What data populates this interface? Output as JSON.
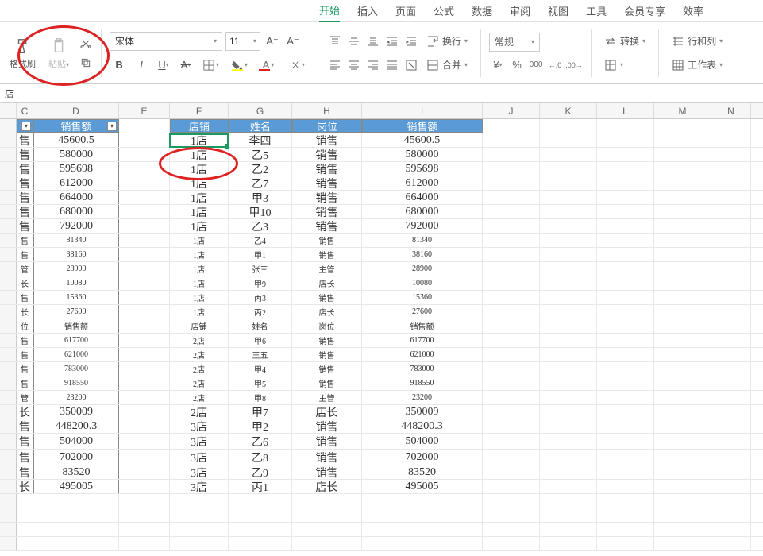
{
  "menu": {
    "start": "开始",
    "insert": "插入",
    "page": "页面",
    "formula": "公式",
    "data": "数据",
    "review": "审阅",
    "view": "视图",
    "tools": "工具",
    "member": "会员专享",
    "efficiency": "效率"
  },
  "ribbon": {
    "format_painter": "格式刷",
    "paste": "粘贴",
    "font_name": "宋体",
    "font_size": "11",
    "wrap": "换行",
    "merge": "合并",
    "number_format": "常规",
    "convert": "转换",
    "row_col": "行和列",
    "worksheet": "工作表"
  },
  "name_box": "店",
  "cols": {
    "c": "C",
    "d": "D",
    "e": "E",
    "f": "F",
    "g": "G",
    "h": "H",
    "i": "I",
    "j": "J",
    "k": "K",
    "l": "L",
    "m": "M",
    "n": "N"
  },
  "left_header": {
    "c": "位",
    "d": "销售额"
  },
  "right_header": {
    "f": "店铺",
    "g": "姓名",
    "h": "岗位",
    "i": "销售额"
  },
  "rows": [
    {
      "c": "售",
      "d": "45600.5",
      "f": "1店",
      "g": "李四",
      "h": "销售",
      "i": "45600.5",
      "big": true
    },
    {
      "c": "售",
      "d": "580000",
      "f": "1店",
      "g": "乙5",
      "h": "销售",
      "i": "580000",
      "big": true
    },
    {
      "c": "售",
      "d": "595698",
      "f": "1店",
      "g": "乙2",
      "h": "销售",
      "i": "595698",
      "big": true
    },
    {
      "c": "售",
      "d": "612000",
      "f": "1店",
      "g": "乙7",
      "h": "销售",
      "i": "612000",
      "big": true
    },
    {
      "c": "售",
      "d": "664000",
      "f": "1店",
      "g": "甲3",
      "h": "销售",
      "i": "664000",
      "big": true
    },
    {
      "c": "售",
      "d": "680000",
      "f": "1店",
      "g": "甲10",
      "h": "销售",
      "i": "680000",
      "big": true
    },
    {
      "c": "售",
      "d": "792000",
      "f": "1店",
      "g": "乙3",
      "h": "销售",
      "i": "792000",
      "big": true
    },
    {
      "c": "售",
      "d": "81340",
      "f": "1店",
      "g": "乙4",
      "h": "销售",
      "i": "81340",
      "big": false
    },
    {
      "c": "售",
      "d": "38160",
      "f": "1店",
      "g": "甲1",
      "h": "销售",
      "i": "38160",
      "big": false
    },
    {
      "c": "管",
      "d": "28900",
      "f": "1店",
      "g": "张三",
      "h": "主管",
      "i": "28900",
      "big": false
    },
    {
      "c": "长",
      "d": "10080",
      "f": "1店",
      "g": "甲9",
      "h": "店长",
      "i": "10080",
      "big": false
    },
    {
      "c": "售",
      "d": "15360",
      "f": "1店",
      "g": "丙3",
      "h": "销售",
      "i": "15360",
      "big": false
    },
    {
      "c": "长",
      "d": "27600",
      "f": "1店",
      "g": "丙2",
      "h": "店长",
      "i": "27600",
      "big": false
    },
    {
      "c": "位",
      "d": "销售额",
      "f": "店铺",
      "g": "姓名",
      "h": "岗位",
      "i": "销售额",
      "big": false
    },
    {
      "c": "售",
      "d": "617700",
      "f": "2店",
      "g": "甲6",
      "h": "销售",
      "i": "617700",
      "big": false
    },
    {
      "c": "售",
      "d": "621000",
      "f": "2店",
      "g": "王五",
      "h": "销售",
      "i": "621000",
      "big": false
    },
    {
      "c": "售",
      "d": "783000",
      "f": "2店",
      "g": "甲4",
      "h": "销售",
      "i": "783000",
      "big": false
    },
    {
      "c": "售",
      "d": "918550",
      "f": "2店",
      "g": "甲5",
      "h": "销售",
      "i": "918550",
      "big": false
    },
    {
      "c": "管",
      "d": "23200",
      "f": "2店",
      "g": "甲8",
      "h": "主管",
      "i": "23200",
      "big": false
    },
    {
      "c": "长",
      "d": "350009",
      "f": "2店",
      "g": "甲7",
      "h": "店长",
      "i": "350009",
      "big": true
    },
    {
      "c": "售",
      "d": "448200.3",
      "f": "3店",
      "g": "甲2",
      "h": "销售",
      "i": "448200.3",
      "big": true
    },
    {
      "c": "售",
      "d": "504000",
      "f": "3店",
      "g": "乙6",
      "h": "销售",
      "i": "504000",
      "big": true,
      "extra": true
    },
    {
      "c": "售",
      "d": "702000",
      "f": "3店",
      "g": "乙8",
      "h": "销售",
      "i": "702000",
      "big": true,
      "extra": true
    },
    {
      "c": "售",
      "d": "83520",
      "f": "3店",
      "g": "乙9",
      "h": "销售",
      "i": "83520",
      "big": true
    },
    {
      "c": "长",
      "d": "495005",
      "f": "3店",
      "g": "丙1",
      "h": "店长",
      "i": "495005",
      "big": true
    }
  ]
}
